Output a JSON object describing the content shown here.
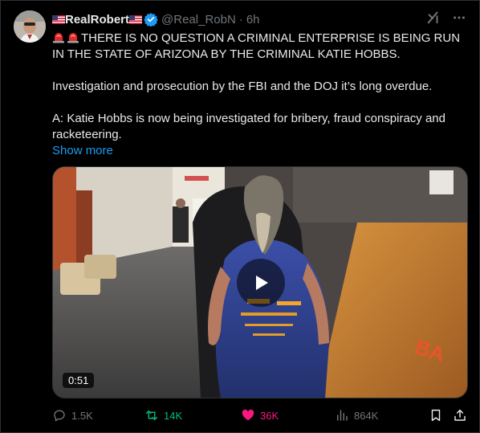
{
  "author": {
    "display_name": "RealRobert",
    "handle": "@Real_RobN",
    "separator": "·",
    "time": "6h"
  },
  "tweet": {
    "paragraph1": "THERE IS NO QUESTION A CRIMINAL ENTERPRISE IS BEING RUN IN THE STATE OF ARIZONA BY THE CRIMINAL KATIE HOBBS.",
    "paragraph2": "Investigation and prosecution by the FBI and the DOJ it’s long overdue.",
    "paragraph3": "A: Katie Hobbs is now being investigated  for bribery, fraud conspiracy and racketeering.",
    "show_more": "Show more"
  },
  "video": {
    "duration": "0:51"
  },
  "actions": {
    "replies": "1.5K",
    "reposts": "14K",
    "likes": "36K",
    "views": "864K"
  },
  "colors": {
    "background": "#000000",
    "text": "#e7e9ea",
    "muted": "#71767b",
    "link": "#1d9bf0",
    "retweet": "#00ba7c",
    "like": "#f91880",
    "verified": "#1d9bf0"
  },
  "icons": [
    "flag-us-icon",
    "verified-badge-icon",
    "grok-icon",
    "more-icon",
    "siren-icon",
    "play-icon",
    "reply-icon",
    "repost-icon",
    "like-icon",
    "views-icon",
    "bookmark-icon",
    "share-icon"
  ]
}
